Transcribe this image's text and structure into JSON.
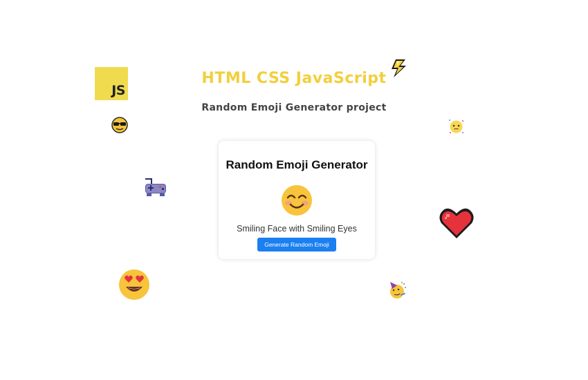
{
  "header": {
    "title": "HTML CSS JavaScript",
    "subtitle": "Random Emoji Generator project"
  },
  "card": {
    "title": "Random Emoji Generator",
    "emoji_name": "Smiling Face with Smiling Eyes",
    "button_label": "Generate Random Emoji"
  },
  "decorations": {
    "js_logo_text": "JS"
  },
  "colors": {
    "title": "#f2cf3c",
    "subtitle": "#444444",
    "button": "#1a7ff0",
    "js_logo": "#f0db4f",
    "emoji_face": "#f7c43b"
  }
}
